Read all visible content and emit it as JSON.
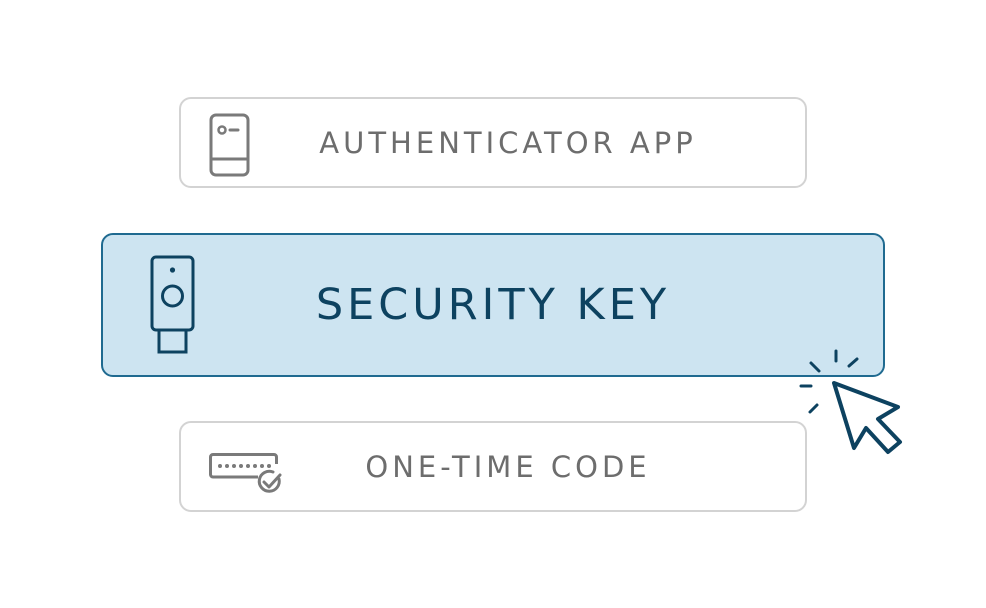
{
  "options": [
    {
      "id": "authenticator-app",
      "label": "AUTHENTICATOR APP",
      "icon": "phone-icon",
      "selected": false
    },
    {
      "id": "security-key",
      "label": "SECURITY KEY",
      "icon": "usb-security-key-icon",
      "selected": true
    },
    {
      "id": "one-time-code",
      "label": "ONE-TIME CODE",
      "icon": "code-check-icon",
      "selected": false
    }
  ],
  "cursor": {
    "icon": "pointer-cursor-click-icon"
  },
  "colors": {
    "selected_bg": "#cde4f1",
    "selected_border": "#1f6a90",
    "selected_text": "#0d4260",
    "default_border": "#d3d3d3",
    "default_text": "#6d6d6d",
    "icon_gray": "#7a7a7a"
  }
}
